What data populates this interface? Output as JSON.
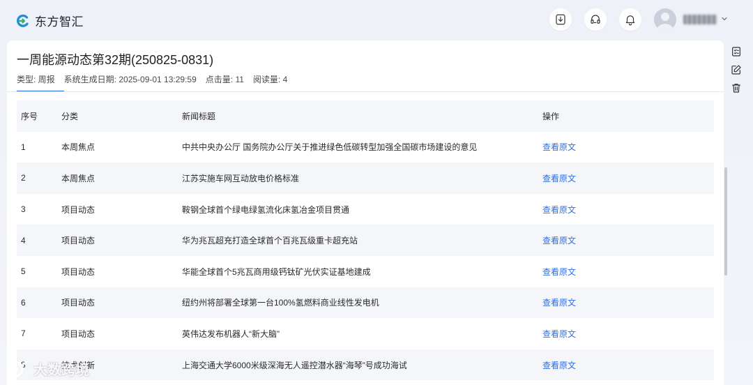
{
  "app": {
    "brand": "东方智汇"
  },
  "report": {
    "title": "一周能源动态第32期(250825-0831)",
    "meta": {
      "type": "类型: 周报",
      "generated": "系统生成日期: 2025-09-01 13:29:59",
      "clicks": "点击量: 11",
      "reads": "阅读量: 4"
    }
  },
  "table": {
    "headers": {
      "no": "序号",
      "category": "分类",
      "title": "新闻标题",
      "action": "操作"
    },
    "rows": [
      {
        "no": "1",
        "category": "本周焦点",
        "title": "中共中央办公厅 国务院办公厅关于推进绿色低碳转型加强全国碳市场建设的意见",
        "action": "查看原文"
      },
      {
        "no": "2",
        "category": "本周焦点",
        "title": "江苏实施车网互动放电价格标准",
        "action": "查看原文"
      },
      {
        "no": "3",
        "category": "项目动态",
        "title": "鞍钢全球首个绿电绿氢流化床氢冶金项目贯通",
        "action": "查看原文"
      },
      {
        "no": "4",
        "category": "项目动态",
        "title": "华为兆瓦超充打造全球首个百兆瓦级重卡超充站",
        "action": "查看原文"
      },
      {
        "no": "5",
        "category": "项目动态",
        "title": "华能全球首个5兆瓦商用级钙钛矿光伏实证基地建成",
        "action": "查看原文"
      },
      {
        "no": "6",
        "category": "项目动态",
        "title": "纽约州将部署全球第一台100%氢燃料商业线性发电机",
        "action": "查看原文"
      },
      {
        "no": "7",
        "category": "项目动态",
        "title": "英伟达发布机器人“新大脑”",
        "action": "查看原文"
      },
      {
        "no": "8",
        "category": "技术创新",
        "title": "上海交通大学6000米级深海无人遥控潜水器“海琴”号成功海试",
        "action": "查看原文"
      }
    ]
  },
  "watermark": {
    "text": "大数跨境"
  },
  "icons": {
    "download": "download-icon",
    "support": "headset-icon",
    "notify": "bell-icon",
    "avatar": "user-avatar-icon",
    "checklist": "checklist-icon",
    "edit": "edit-icon",
    "delete": "trash-icon"
  },
  "colors": {
    "accent": "#2f6fe4",
    "header_bg": "#f4f6fa",
    "page_bg": "#eef1f8"
  }
}
